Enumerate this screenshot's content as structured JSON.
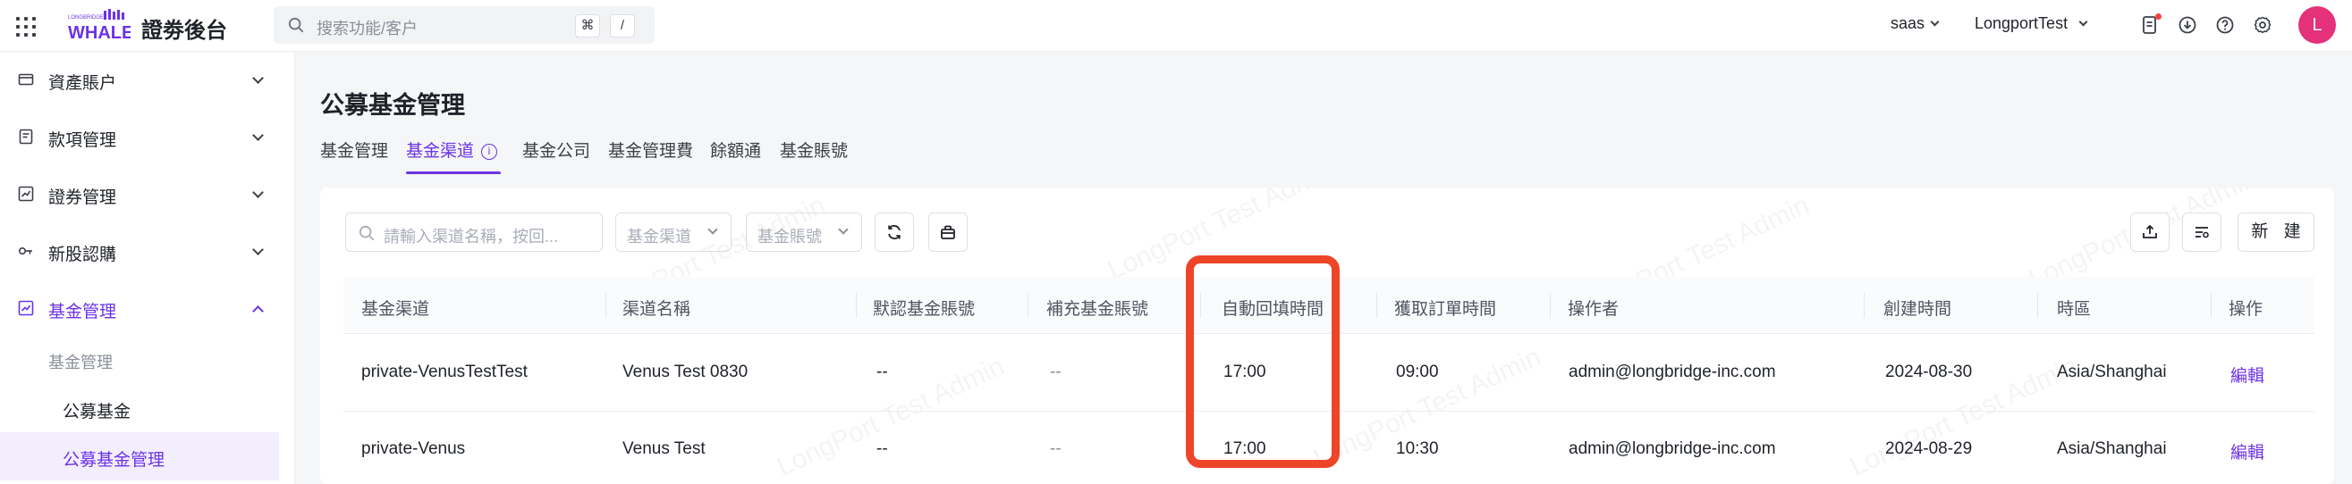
{
  "topbar": {
    "brand_small": "LONGBRIDGE",
    "brand_logo": "WHALE",
    "app_title": "證劵後台",
    "search_placeholder": "搜索功能/客户",
    "shortcut_keys": [
      "⌘",
      "/"
    ],
    "tenant": "saas",
    "account": "LongportTest",
    "avatar_letter": "L",
    "icons": [
      "apps-grid-icon",
      "search-icon",
      "task-list-icon",
      "download-icon",
      "help-icon",
      "settings-icon"
    ],
    "accent_color": "#6b33e6"
  },
  "sidebar": {
    "items": [
      {
        "label": "資產賬户",
        "icon": "wallet-icon"
      },
      {
        "label": "款項管理",
        "icon": "document-icon"
      },
      {
        "label": "證券管理",
        "icon": "chart-box-icon"
      },
      {
        "label": "新股認購",
        "icon": "ipo-icon"
      },
      {
        "label": "基金管理",
        "icon": "fund-icon"
      }
    ],
    "sub_group": "基金管理",
    "sub_items": [
      "公募基金",
      "公募基金管理"
    ]
  },
  "main": {
    "title": "公募基金管理",
    "tabs": [
      "基金管理",
      "基金渠道",
      "基金公司",
      "基金管理費",
      "餘額通",
      "基金賬號"
    ],
    "info_mark": "i",
    "filters": {
      "search_placeholder": "請輸入渠道名稱，按回...",
      "channel_select": "基金渠道",
      "account_select": "基金賬號"
    },
    "new_button": "新 建",
    "columns": [
      "基金渠道",
      "渠道名稱",
      "默認基金賬號",
      "補充基金賬號",
      "自動回填時間",
      "獲取訂單時間",
      "操作者",
      "創建時間",
      "時區",
      "操作"
    ],
    "rows": [
      {
        "channel": "private-VenusTestTest",
        "name": "Venus Test 0830",
        "default_account": "--",
        "extra_account": "--",
        "backfill_time": "17:00",
        "order_time": "09:00",
        "operator": "admin@longbridge-inc.com",
        "created": "2024-08-30",
        "timezone": "Asia/Shanghai",
        "action": "編輯"
      },
      {
        "channel": "private-Venus",
        "name": "Venus Test",
        "default_account": "--",
        "extra_account": "--",
        "backfill_time": "17:00",
        "order_time": "10:30",
        "operator": "admin@longbridge-inc.com",
        "created": "2024-08-29",
        "timezone": "Asia/Shanghai",
        "action": "編輯"
      }
    ],
    "watermark": "LongPort Test Admin",
    "highlight_color": "#ee4528"
  }
}
